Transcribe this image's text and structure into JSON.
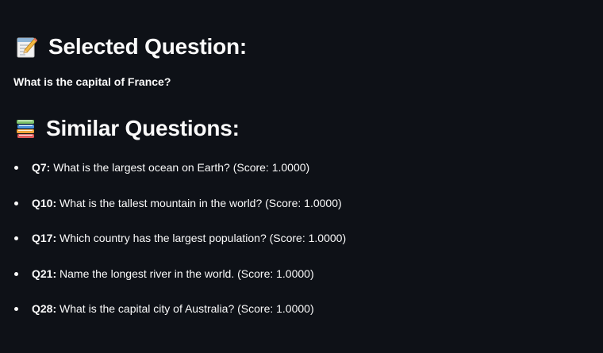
{
  "selected_section": {
    "icon": "memo-icon",
    "heading": "Selected Question:",
    "question": "What is the capital of France?"
  },
  "similar_section": {
    "icon": "books-icon",
    "heading": "Similar Questions:",
    "items": [
      {
        "id": "Q7:",
        "text": " What is the largest ocean on Earth? (Score: 1.0000)"
      },
      {
        "id": "Q10:",
        "text": " What is the tallest mountain in the world? (Score: 1.0000)"
      },
      {
        "id": "Q17:",
        "text": " Which country has the largest population? (Score: 1.0000)"
      },
      {
        "id": "Q21:",
        "text": " Name the longest river in the world. (Score: 1.0000)"
      },
      {
        "id": "Q28:",
        "text": " What is the capital city of Australia? (Score: 1.0000)"
      }
    ]
  }
}
